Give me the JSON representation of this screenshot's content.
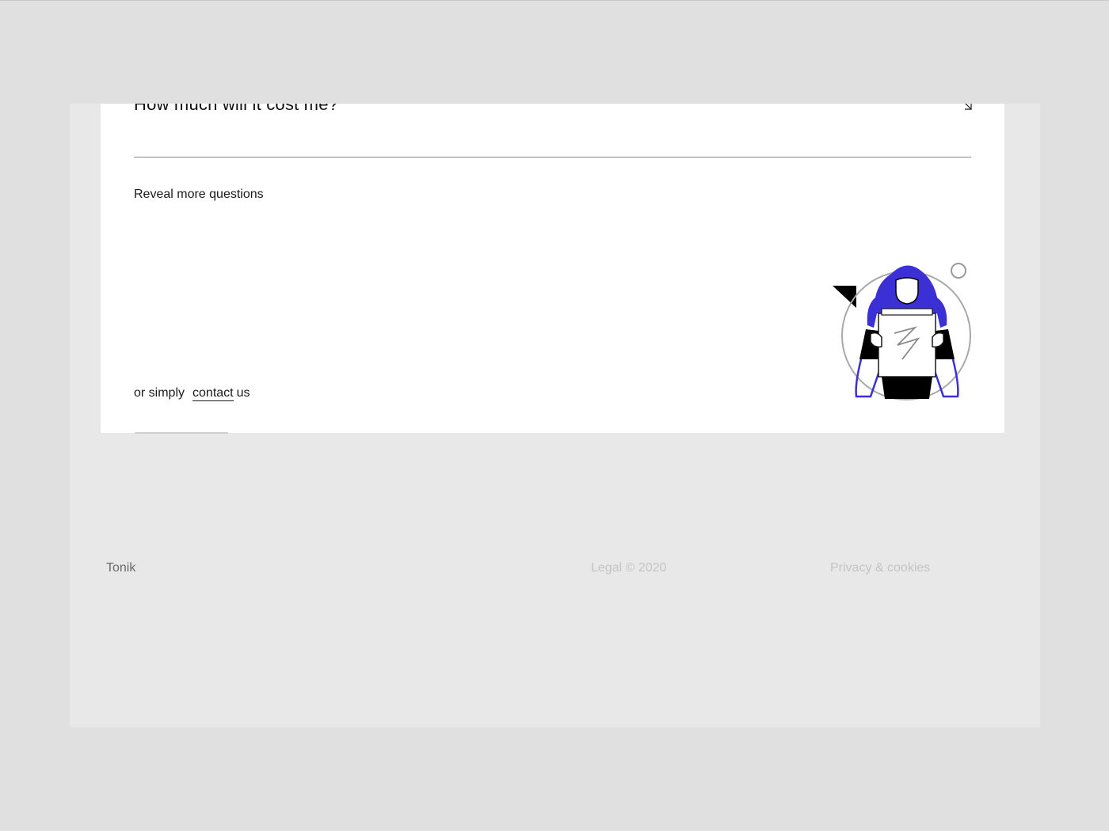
{
  "faq": {
    "question": "How much will it cost me?",
    "reveal_more_label": "Reveal more questions"
  },
  "contact": {
    "prefix": "or simply",
    "link_label": "contact",
    "suffix": "us"
  },
  "footer": {
    "brand": "Tonik",
    "legal": "Legal © 2020",
    "privacy": "Privacy & cookies"
  },
  "colors": {
    "accent": "#3b2fd6",
    "page_bg": "#e0e0e0",
    "card_bg": "#ffffff",
    "text": "#1a1a1a"
  },
  "icons": {
    "faq_toggle": "arrow-down-right-icon",
    "illustration": "woman-holding-box-illustration"
  }
}
